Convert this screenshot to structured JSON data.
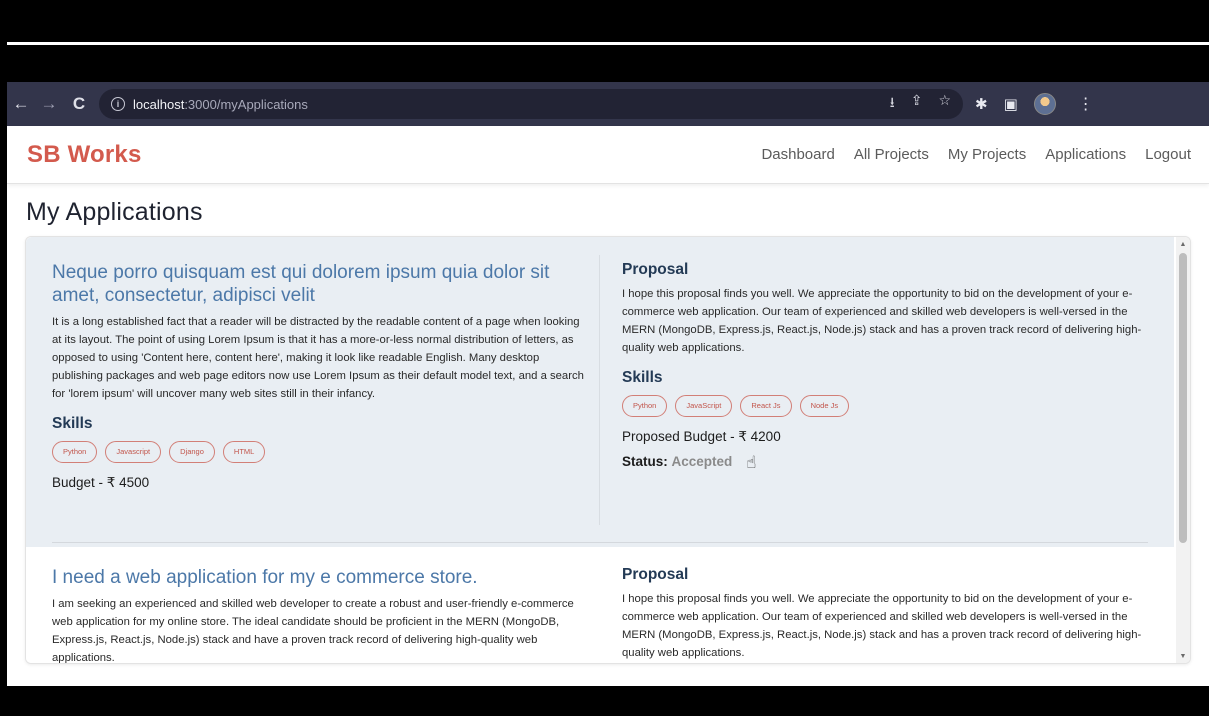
{
  "browser": {
    "url_host": "localhost",
    "url_path": ":3000/myApplications"
  },
  "app": {
    "brand": "SB Works",
    "nav": [
      "Dashboard",
      "All Projects",
      "My Projects",
      "Applications",
      "Logout"
    ]
  },
  "page": {
    "title": "My Applications"
  },
  "applications": [
    {
      "project_title": "Neque porro quisquam est qui dolorem ipsum quia dolor sit amet, consectetur, adipisci velit",
      "description": "It is a long established fact that a reader will be distracted by the readable content of a page when looking at its layout. The point of using Lorem Ipsum is that it has a more-or-less normal distribution of letters, as opposed to using 'Content here, content here', making it look like readable English. Many desktop publishing packages and web page editors now use Lorem Ipsum as their default model text, and a search for 'lorem ipsum' will uncover many web sites still in their infancy.",
      "skills_heading": "Skills",
      "skills": [
        "Python",
        "Javascript",
        "Django",
        "HTML"
      ],
      "budget": "Budget - ₹ 4500",
      "proposal_heading": "Proposal",
      "proposal": "I hope this proposal finds you well. We appreciate the opportunity to bid on the development of your e-commerce web application. Our team of experienced and skilled web developers is well-versed in the MERN (MongoDB, Express.js, React.js, Node.js) stack and has a proven track record of delivering high-quality web applications.",
      "proposal_skills_heading": "Skills",
      "proposal_skills": [
        "Python",
        "JavaScript",
        "React Js",
        "Node Js"
      ],
      "proposed_budget": "Proposed Budget - ₹ 4200",
      "status_label": "Status:",
      "status_value": "Accepted"
    },
    {
      "project_title": "I need a web application for my e commerce store.",
      "description": "I am seeking an experienced and skilled web developer to create a robust and user-friendly e-commerce web application for my online store. The ideal candidate should be proficient in the MERN (MongoDB, Express.js, React.js, Node.js) stack and have a proven track record of delivering high-quality web applications.",
      "proposal_heading": "Proposal",
      "proposal": "I hope this proposal finds you well. We appreciate the opportunity to bid on the development of your e-commerce web application. Our team of experienced and skilled web developers is well-versed in the MERN (MongoDB, Express.js, React.js, Node.js) stack and has a proven track record of delivering high-quality web applications."
    }
  ]
}
